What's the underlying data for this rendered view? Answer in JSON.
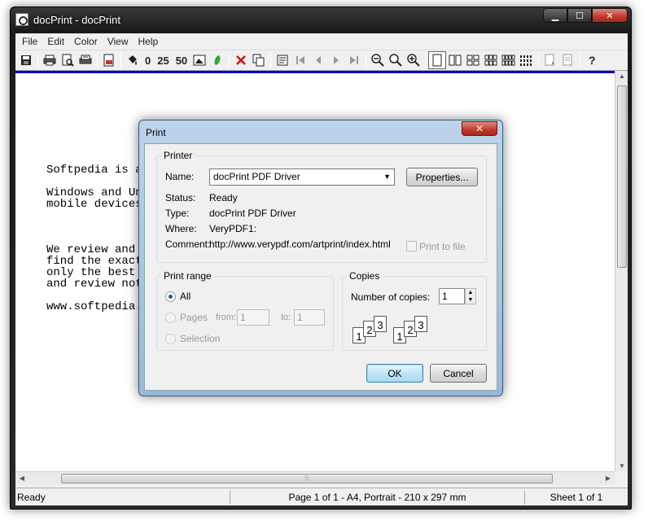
{
  "window": {
    "title": "docPrint - docPrint",
    "minimize": "▁",
    "maximize": "☐",
    "close": "✕"
  },
  "menu": [
    "File",
    "Edit",
    "Color",
    "View",
    "Help"
  ],
  "toolbar": {
    "zoom_0": "0",
    "zoom_25": "25",
    "zoom_50": "50"
  },
  "document": {
    "lines": [
      "Softpedia is a                                     e programs for",
      "",
      "Windows and Un",
      "mobile devices",
      "",
      "",
      "",
      "We review and                                      or/user to",
      "find the exact                                     liver",
      "only the best                                      evaluation",
      "and review not",
      "",
      "www.softpedia."
    ]
  },
  "status": {
    "ready": "Ready",
    "page": "Page 1 of 1 - A4, Portrait - 210 x 297 mm",
    "sheet": "Sheet 1 of 1"
  },
  "dialog": {
    "title": "Print",
    "close": "✕",
    "printer": {
      "group": "Printer",
      "name_label": "Name:",
      "name_value": "docPrint PDF Driver",
      "properties": "Properties...",
      "status_label": "Status:",
      "status_value": "Ready",
      "type_label": "Type:",
      "type_value": "docPrint PDF Driver",
      "where_label": "Where:",
      "where_value": "VeryPDF1:",
      "comment_label": "Comment:",
      "comment_value": "http://www.verypdf.com/artprint/index.html",
      "print_to_file": "Print to file"
    },
    "range": {
      "group": "Print range",
      "all": "All",
      "pages": "Pages",
      "from_label": "from:",
      "from_value": "1",
      "to_label": "to:",
      "to_value": "1",
      "selection": "Selection"
    },
    "copies": {
      "group": "Copies",
      "number_label": "Number of copies:",
      "number_value": "1",
      "collate_pages": [
        "1",
        "2",
        "3"
      ]
    },
    "ok": "OK",
    "cancel": "Cancel"
  },
  "scroll": {
    "up": "▲",
    "down": "▼",
    "left": "◀",
    "right": "▶",
    "grip": "⦙⦙⦙"
  }
}
